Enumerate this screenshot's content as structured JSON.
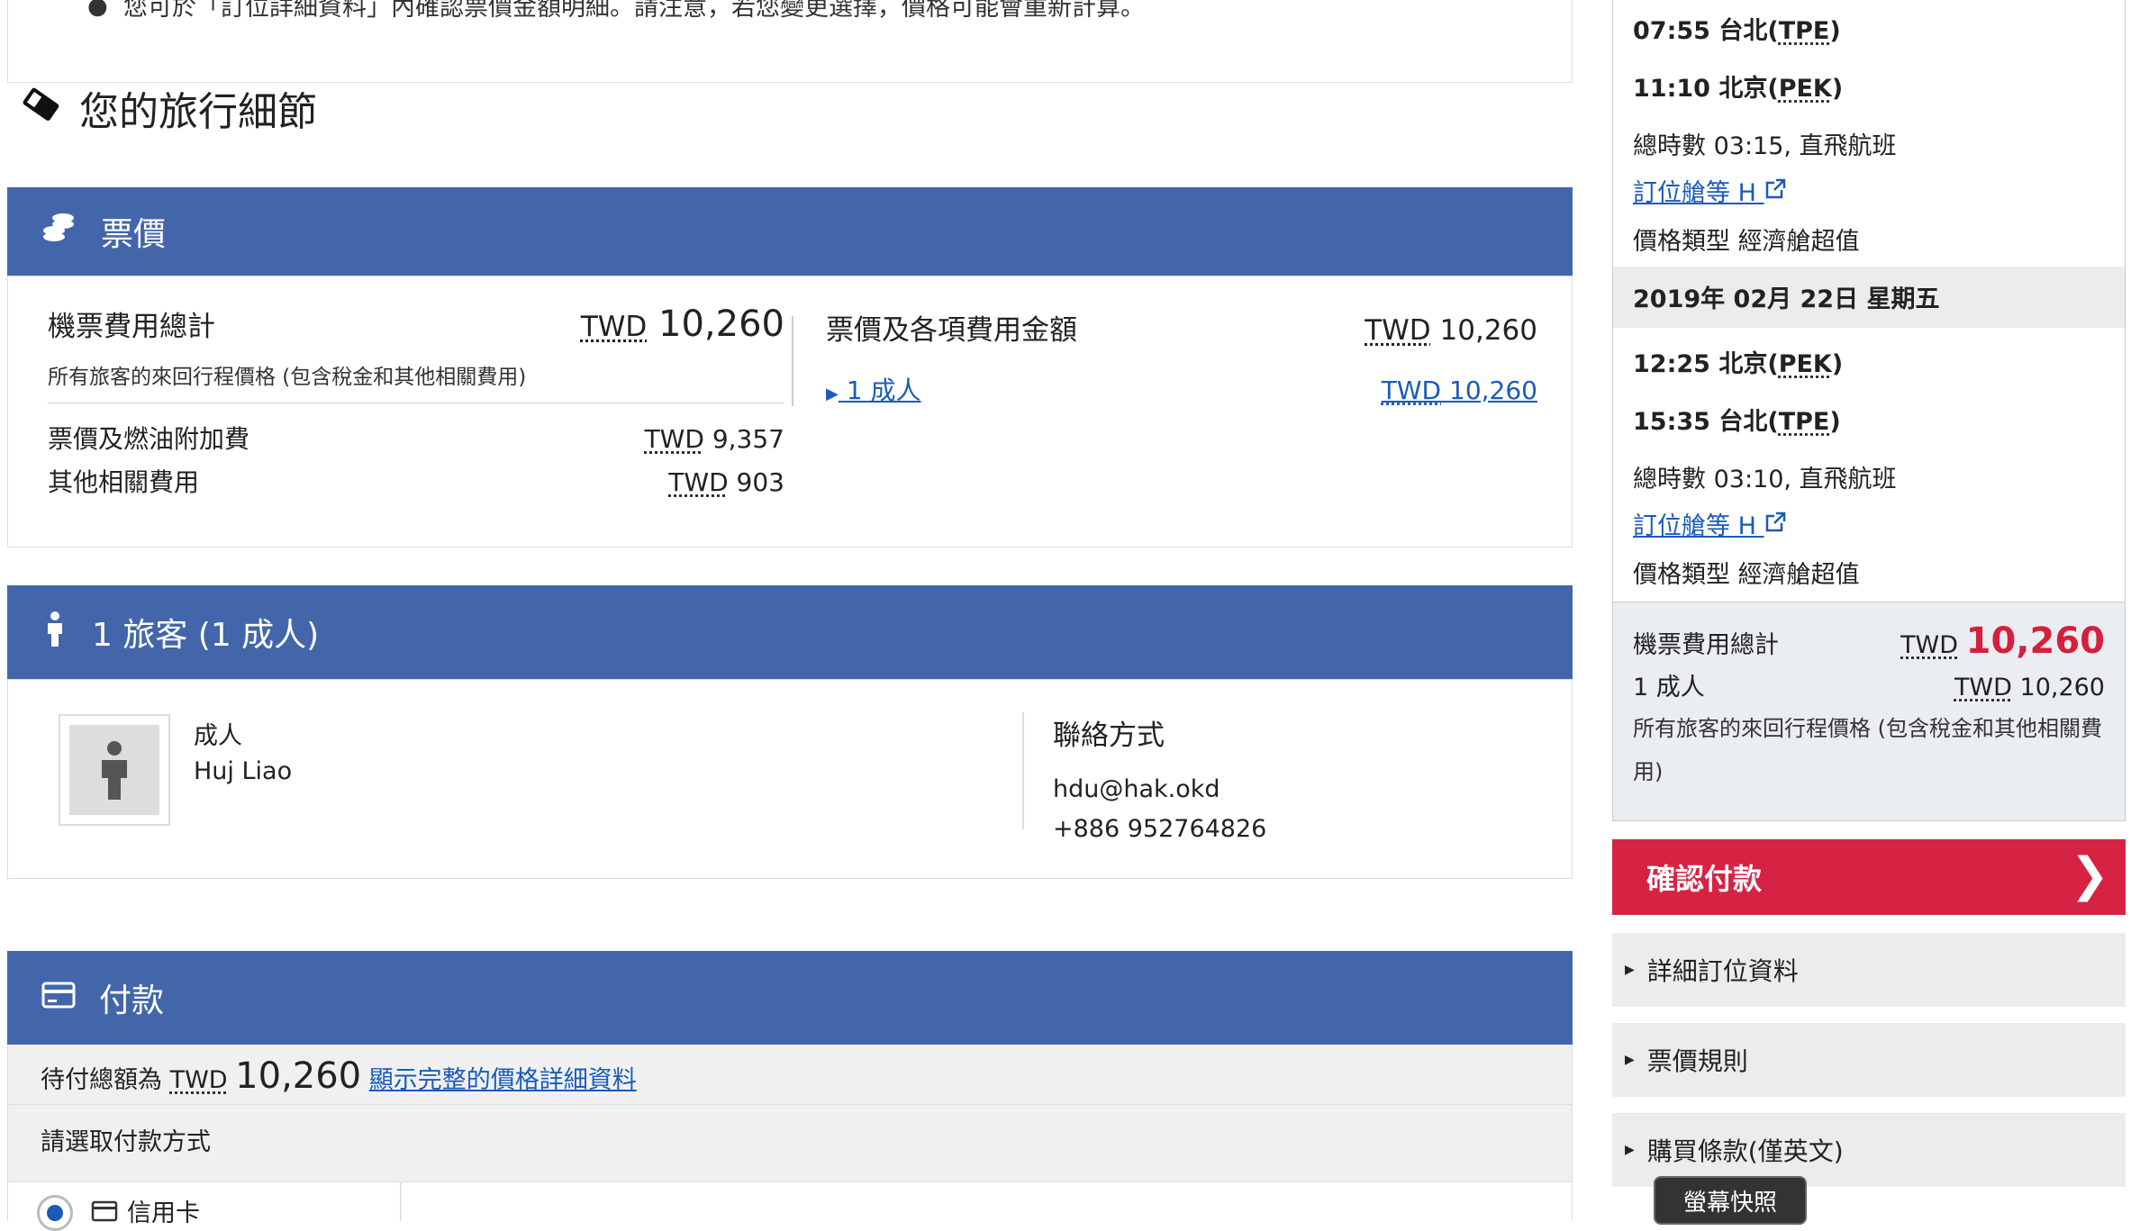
{
  "notice": {
    "text": "您可於「訂位詳細資料」內確認票價金額明細。請注意，若您變更選擇，價格可能會重新計算。"
  },
  "trip_section": {
    "title": "您的旅行細節"
  },
  "fare_panel": {
    "title": "票價",
    "total_label": "機票費用總計",
    "total_currency": "TWD",
    "total_amount": "10,260",
    "total_note": "所有旅客的來回行程價格 (包含稅金和其他相關費用)",
    "lines": [
      {
        "label": "票價及燃油附加費",
        "currency": "TWD",
        "amount": "9,357"
      },
      {
        "label": "其他相關費用",
        "currency": "TWD",
        "amount": "903"
      }
    ],
    "breakdown_label": "票價及各項費用金額",
    "breakdown_currency": "TWD",
    "breakdown_amount": "10,260",
    "adult_link": "1 成人",
    "adult_currency": "TWD",
    "adult_amount": "10,260"
  },
  "traveler_panel": {
    "title": "1 旅客 (1 成人)",
    "type": "成人",
    "name": "Huj Liao",
    "contact_label": "聯絡方式",
    "email": "hdu@hak.okd",
    "phone": "+886 952764826"
  },
  "payment_panel": {
    "title": "付款",
    "due_prefix": "待付總額為",
    "due_currency": "TWD",
    "due_amount": "10,260",
    "details_link": "顯示完整的價格詳細資料",
    "choose_label": "請選取付款方式",
    "method_credit": "信用卡"
  },
  "itinerary": {
    "outbound": {
      "depart": "07:55 台北(",
      "depart_code": "TPE",
      "arrive": "11:10 北京(",
      "arrive_code": "PEK",
      "duration": "總時數 03:15, 直飛航班",
      "booking_class": "訂位艙等 H",
      "fare_type": "價格類型 經濟艙超值"
    },
    "return_date": "2019年 02月 22日 星期五",
    "inbound": {
      "depart": "12:25 北京(",
      "depart_code": "PEK",
      "arrive": "15:35 台北(",
      "arrive_code": "TPE",
      "duration": "總時數 03:10, 直飛航班",
      "booking_class": "訂位艙等 H",
      "fare_type": "價格類型 經濟艙超值"
    }
  },
  "summary": {
    "total_label": "機票費用總計",
    "total_currency": "TWD",
    "total_amount": "10,260",
    "adult_label": "1 成人",
    "adult_currency": "TWD",
    "adult_amount": "10,260",
    "note": "所有旅客的來回行程價格 (包含稅金和其他相關費用)"
  },
  "confirm_button": {
    "label": "確認付款"
  },
  "accordions": [
    "詳細訂位資料",
    "票價規則",
    "購買條款(僅英文)"
  ],
  "tooltip": {
    "label": "螢幕快照"
  },
  "colors": {
    "panel_header": "#4266a9",
    "confirm": "#d72343",
    "link": "#1a5bb8",
    "total_red": "#d5203c"
  }
}
